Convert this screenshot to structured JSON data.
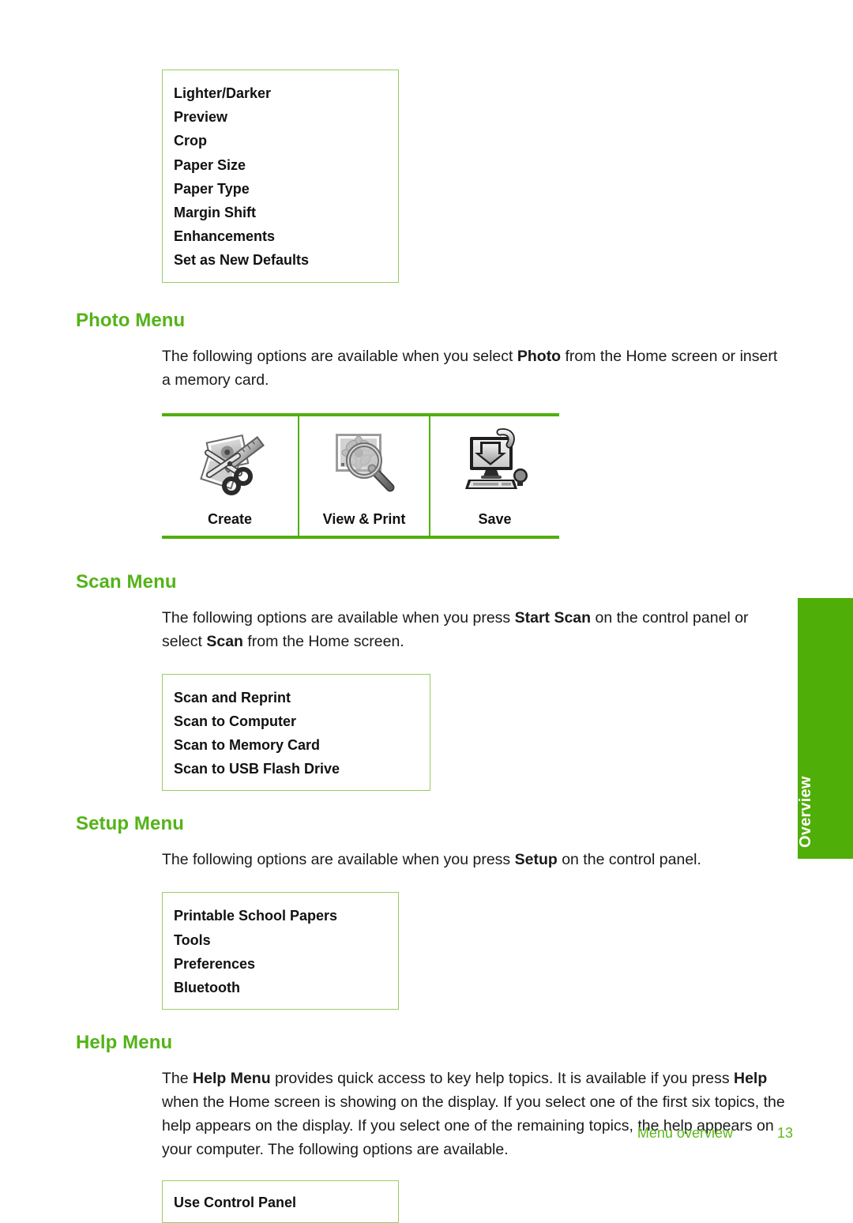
{
  "side_tab": {
    "label": "Overview",
    "color": "#4FAE08"
  },
  "copy_menu_box": {
    "options": [
      "Lighter/Darker",
      "Preview",
      "Crop",
      "Paper Size",
      "Paper Type",
      "Margin Shift",
      "Enhancements",
      "Set as New Defaults"
    ]
  },
  "photo_menu": {
    "heading": "Photo Menu",
    "intro_1": "The following options are available when you select ",
    "intro_bold": "Photo",
    "intro_2": " from the Home screen or insert a memory card.",
    "table": {
      "columns": [
        {
          "label": "Create",
          "icon": "scissors-photos-ruler-icon"
        },
        {
          "label": "View & Print",
          "icon": "magnifier-photo-icon"
        },
        {
          "label": "Save",
          "icon": "computer-download-icon"
        }
      ]
    }
  },
  "scan_menu": {
    "heading": "Scan Menu",
    "intro_1": "The following options are available when you press ",
    "intro_bold_1": "Start Scan",
    "intro_2": " on the control panel or select ",
    "intro_bold_2": "Scan",
    "intro_3": " from the Home screen.",
    "options": [
      "Scan and Reprint",
      "Scan to Computer",
      "Scan to Memory Card",
      "Scan to USB Flash Drive"
    ]
  },
  "setup_menu": {
    "heading": "Setup Menu",
    "intro_1": "The following options are available when you press ",
    "intro_bold": "Setup",
    "intro_2": " on the control panel.",
    "options": [
      "Printable School Papers",
      "Tools",
      "Preferences",
      "Bluetooth"
    ]
  },
  "help_menu": {
    "heading": "Help Menu",
    "intro_1": "The ",
    "intro_bold_1": "Help Menu",
    "intro_2": " provides quick access to key help topics. It is available if you press ",
    "intro_bold_2": "Help",
    "intro_3": " when the Home screen is showing on the display. If you select one of the first six topics, the help appears on the display. If you select one of the remaining topics, the help appears on your computer. The following options are available.",
    "options": [
      "Use Control Panel"
    ]
  },
  "footer": {
    "title": "Menu overview",
    "page": "13",
    "color": "#5BB81B"
  }
}
